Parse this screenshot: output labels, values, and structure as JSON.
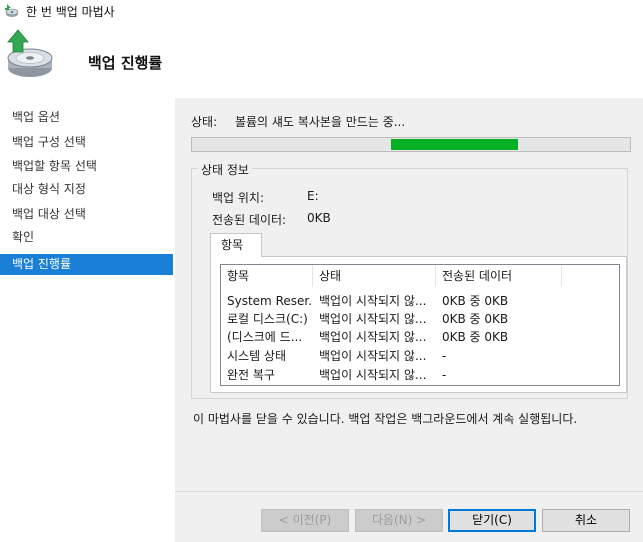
{
  "window": {
    "title": "한 번 백업 마법사"
  },
  "header": {
    "title": "백업 진행률"
  },
  "sidebar": {
    "items": [
      {
        "label": "백업 옵션"
      },
      {
        "label": "백업 구성 선택"
      },
      {
        "label": "백업할 항목 선택"
      },
      {
        "label": "대상 형식 지정"
      },
      {
        "label": "백업 대상 선택"
      },
      {
        "label": "확인"
      },
      {
        "label": "백업 진행률"
      }
    ],
    "active_index": 6
  },
  "status": {
    "label": "상태:",
    "text": "볼륨의 섀도 복사본을 만드는 중...",
    "progress_start": 0.455,
    "progress_end": 0.745,
    "progress_color": "#06b025"
  },
  "status_info": {
    "legend": "상태 정보",
    "backup_location_label": "백업 위치:",
    "backup_location_value": "E:",
    "transferred_label": "전송된 데이터:",
    "transferred_value": "0KB"
  },
  "tab": {
    "label": "항목"
  },
  "table": {
    "columns": [
      "항목",
      "상태",
      "전송된 데이터"
    ],
    "rows": [
      [
        "System Reser...",
        "백업이 시작되지 않...",
        "0KB 중 0KB"
      ],
      [
        "로컬 디스크(C:)",
        "백업이 시작되지 않...",
        "0KB 중 0KB"
      ],
      [
        "(디스크에 드...",
        "백업이 시작되지 않...",
        "0KB 중 0KB"
      ],
      [
        "시스템 상태",
        "백업이 시작되지 않...",
        "-"
      ],
      [
        "완전 복구",
        "백업이 시작되지 않...",
        "-"
      ]
    ]
  },
  "notice": "이 마법사를 닫을 수 있습니다. 백업 작업은 백그라운드에서 계속 실행됩니다.",
  "buttons": {
    "prev": "< 이전(P)",
    "next": "다음(N) >",
    "close": "닫기(C)",
    "cancel": "취소"
  },
  "colors": {
    "accent": "#1a7fd6",
    "progress": "#06b025"
  }
}
